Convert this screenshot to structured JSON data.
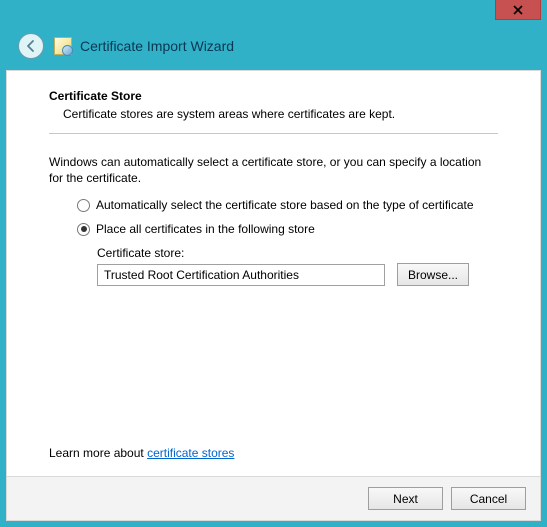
{
  "window": {
    "title": "Certificate Import Wizard"
  },
  "page": {
    "heading": "Certificate Store",
    "subheading": "Certificate stores are system areas where certificates are kept.",
    "body": "Windows can automatically select a certificate store, or you can specify a location for the certificate.",
    "radio_auto": "Automatically select the certificate store based on the type of certificate",
    "radio_place": "Place all certificates in the following store",
    "selected": "place",
    "store_label": "Certificate store:",
    "store_value": "Trusted Root Certification Authorities",
    "browse_label": "Browse...",
    "learn_prefix": "Learn more about ",
    "learn_link": "certificate stores"
  },
  "footer": {
    "next": "Next",
    "cancel": "Cancel"
  }
}
